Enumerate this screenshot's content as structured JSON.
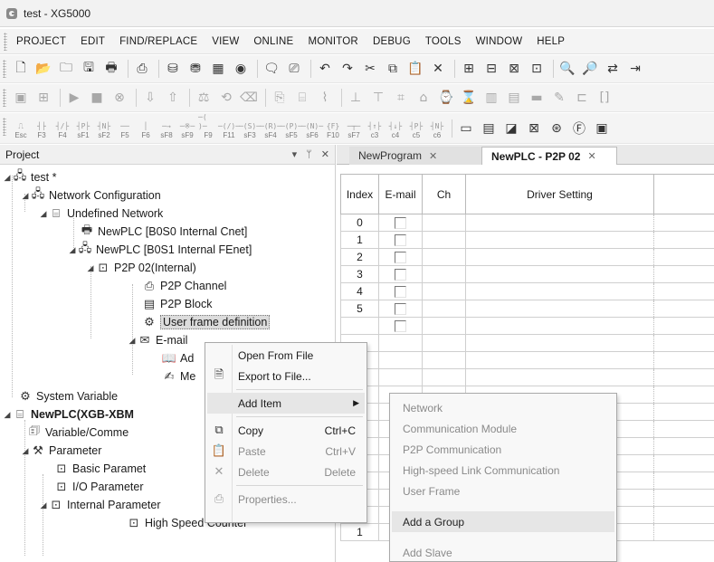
{
  "window": {
    "title": "test - XG5000"
  },
  "menubar": {
    "items": [
      "PROJECT",
      "EDIT",
      "FIND/REPLACE",
      "VIEW",
      "ONLINE",
      "MONITOR",
      "DEBUG",
      "TOOLS",
      "WINDOW",
      "HELP"
    ]
  },
  "function_keys": {
    "labels": [
      "Esc",
      "F3",
      "F4",
      "sF1",
      "sF2",
      "F5",
      "F6",
      "sF8",
      "sF9",
      "F9",
      "F11",
      "sF3",
      "sF4",
      "sF5",
      "sF6",
      "F10",
      "sF7",
      "c3",
      "c4",
      "c5",
      "c6"
    ],
    "symbols": [
      "⎍",
      "┤├",
      "┤/├",
      "┤P├",
      "┤N├",
      "──",
      "│",
      "─→",
      "─※─",
      "─( )─",
      "─(/)─",
      "─(S)─",
      "─(R)─",
      "─(P)─",
      "─(N)─",
      "{F}",
      "─┬─",
      "┤↑├",
      "┤↓├",
      "┤P├",
      "┤N├"
    ]
  },
  "project_pane": {
    "title": "Project",
    "controls": [
      "▾",
      "ᛘ",
      "✕"
    ],
    "tree": [
      {
        "label": "test *"
      },
      {
        "label": "Network Configuration"
      },
      {
        "label": "Undefined Network"
      },
      {
        "label": "NewPLC [B0S0 Internal Cnet]"
      },
      {
        "label": "NewPLC [B0S1 Internal FEnet]"
      },
      {
        "label": "P2P 02(Internal)"
      },
      {
        "label": "P2P Channel"
      },
      {
        "label": "P2P Block"
      },
      {
        "label": "User frame definition"
      },
      {
        "label": "E-mail"
      },
      {
        "label": "Ad"
      },
      {
        "label": "Me"
      },
      {
        "label": "System Variable"
      },
      {
        "label": "NewPLC(XGB-XBM"
      },
      {
        "label": "Variable/Comme"
      },
      {
        "label": "Parameter"
      },
      {
        "label": "Basic Paramet"
      },
      {
        "label": "I/O Parameter"
      },
      {
        "label": "Internal Parameter"
      },
      {
        "label": "High Speed Counter"
      }
    ]
  },
  "tabs": [
    {
      "label": "NewProgram",
      "close": "✕"
    },
    {
      "label": "NewPLC - P2P 02",
      "close": "✕"
    }
  ],
  "grid": {
    "headers": [
      "Index",
      "E-mail",
      "Ch",
      "Driver Setting"
    ],
    "row_indices": [
      "0",
      "1",
      "2",
      "3",
      "4",
      "5",
      "",
      "",
      "",
      "",
      "",
      "",
      "",
      "",
      "",
      "",
      "",
      "1",
      "1"
    ]
  },
  "context_menu": {
    "items": [
      {
        "label": "Open From File",
        "shortcut": "",
        "enabled": true
      },
      {
        "label": "Export to File...",
        "shortcut": "",
        "enabled": true
      },
      {
        "label": "Add Item",
        "shortcut": "",
        "enabled": true,
        "submenu": true
      },
      {
        "label": "Copy",
        "shortcut": "Ctrl+C",
        "enabled": true
      },
      {
        "label": "Paste",
        "shortcut": "Ctrl+V",
        "enabled": false
      },
      {
        "label": "Delete",
        "shortcut": "Delete",
        "enabled": false
      },
      {
        "label": "Properties...",
        "shortcut": "",
        "enabled": false
      }
    ],
    "submenu_arrow": "▶"
  },
  "submenu": {
    "items": [
      {
        "label": "Network",
        "enabled": false
      },
      {
        "label": "Communication Module",
        "enabled": false
      },
      {
        "label": "P2P Communication",
        "enabled": false
      },
      {
        "label": "High-speed Link Communication",
        "enabled": false
      },
      {
        "label": "User Frame",
        "enabled": false
      },
      {
        "label": "Add a Group",
        "enabled": true,
        "highlighted": true
      },
      {
        "label": "Add Slave",
        "enabled": false
      }
    ]
  }
}
